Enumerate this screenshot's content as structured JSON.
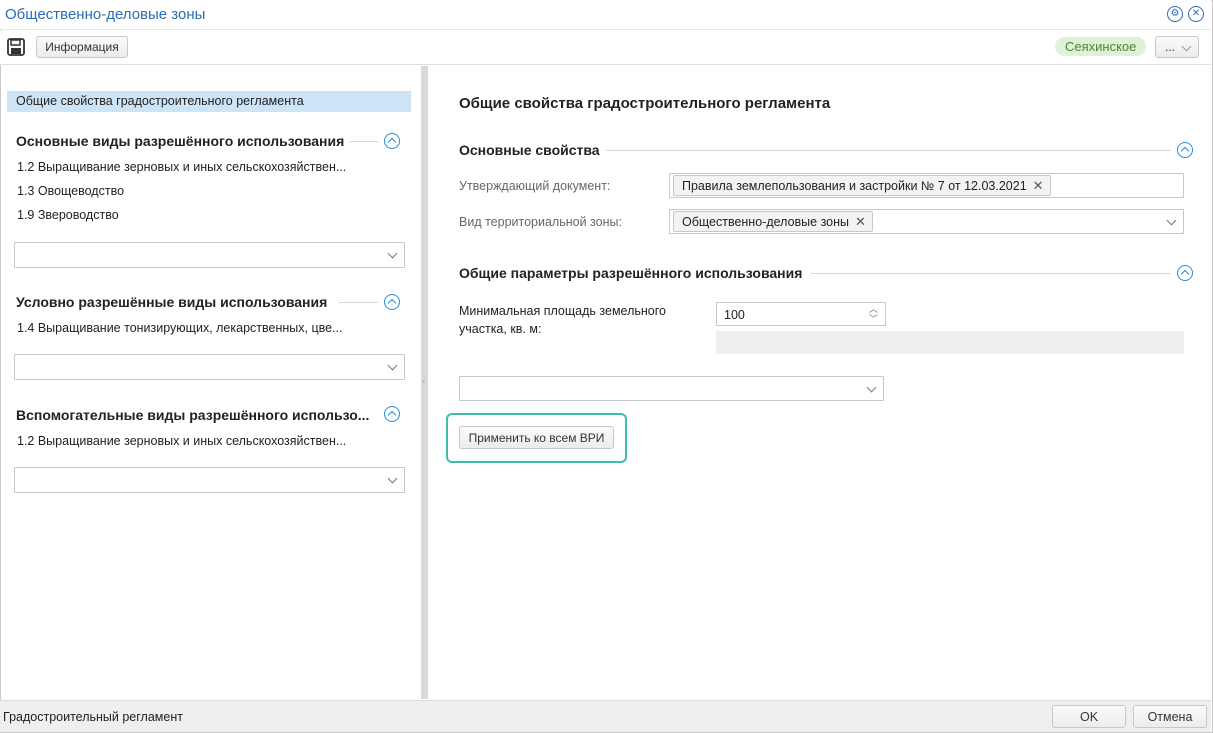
{
  "window": {
    "title": "Общественно-деловые зоны"
  },
  "toolbar": {
    "info_label": "Информация",
    "region_badge": "Сеяхинское",
    "more_label": "..."
  },
  "left": {
    "selected_node": "Общие свойства градостроительного регламента",
    "sections": [
      {
        "title": "Основные виды разрешённого использования",
        "items": [
          "1.2 Выращивание зерновых и иных сельскохозяйствен...",
          "1.3 Овощеводство",
          "1.9 Звероводство"
        ]
      },
      {
        "title": "Условно разрешённые виды использования",
        "items": [
          "1.4 Выращивание тонизирующих, лекарственных, цве..."
        ]
      },
      {
        "title": "Вспомогательные виды разрешённого использо...",
        "items": [
          "1.2 Выращивание зерновых и иных сельскохозяйствен..."
        ]
      }
    ]
  },
  "right": {
    "heading": "Общие свойства градостроительного регламента",
    "basic": {
      "title": "Основные свойства",
      "doc_label": "Утверждающий документ:",
      "doc_value": "Правила землепользования и застройки № 7 от 12.03.2021",
      "zone_label": "Вид территориальной зоны:",
      "zone_value": "Общественно-деловые зоны"
    },
    "params": {
      "title": "Общие параметры разрешённого использования",
      "min_area_label_1": "Минимальная площадь земельного",
      "min_area_label_2": "участка, кв. м:",
      "min_area_value": "100"
    },
    "apply_label": "Применить ко всем ВРИ"
  },
  "status": {
    "text": "Градостроительный регламент",
    "ok_label": "OK",
    "cancel_label": "Отмена"
  }
}
